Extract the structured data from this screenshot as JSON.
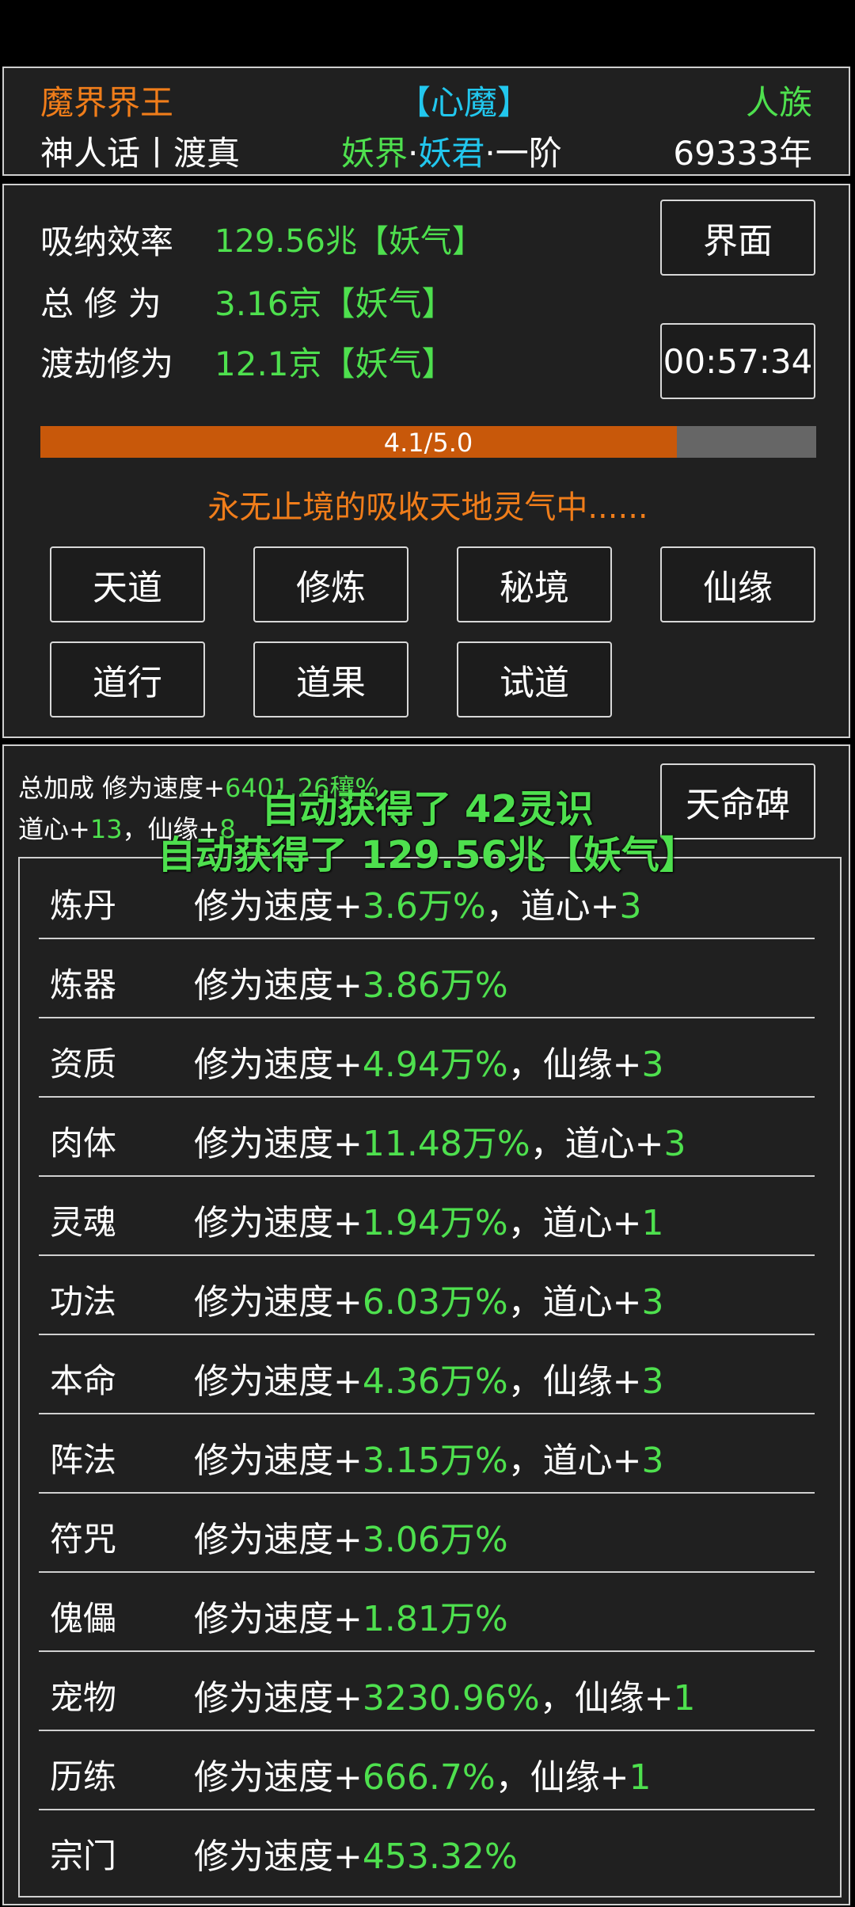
{
  "header": {
    "title_left": "魔界界王",
    "title_center": "【心魔】",
    "title_right": "人族",
    "sub_left": "神人话丨渡真",
    "realm_world": "妖界",
    "realm_dot1": "·",
    "realm_rank": "妖君",
    "realm_stage": "·一阶",
    "age": "69333年"
  },
  "stats": {
    "absorb_label": "吸纳效率",
    "absorb_value": "129.56兆【妖气】",
    "total_label": "总 修 为",
    "total_value": "3.16京【妖气】",
    "tribulation_label": "渡劫修为",
    "tribulation_value": "12.1京【妖气】",
    "interface_button": "界面",
    "timer": "00:57:34",
    "progress_text": "4.1/5.0",
    "progress_fraction": 0.82,
    "status_text": "永无止境的吸收天地灵气中......"
  },
  "actions": [
    "天道",
    "修炼",
    "秘境",
    "仙缘",
    "道行",
    "道果",
    "试道"
  ],
  "bonus": {
    "line1_label": "总加成 修为速度+",
    "line1_value": "6401.26穰%",
    "line2_dao_label": "道心+",
    "line2_dao_value": "13",
    "line2_sep": "，仙缘+",
    "line2_xian_value": "8",
    "tianming_button": "天命碑"
  },
  "notifications": {
    "line1": "自动获得了 42灵识",
    "line2": "自动获得了 129.56兆【妖气】"
  },
  "list": [
    {
      "name": "炼丹",
      "prefix": "修为速度+",
      "value": "3.6万%",
      "extra_label": "，道心+",
      "extra_value": "3"
    },
    {
      "name": "炼器",
      "prefix": "修为速度+",
      "value": "3.86万%",
      "extra_label": "",
      "extra_value": ""
    },
    {
      "name": "资质",
      "prefix": "修为速度+",
      "value": "4.94万%",
      "extra_label": "，仙缘+",
      "extra_value": "3"
    },
    {
      "name": "肉体",
      "prefix": "修为速度+",
      "value": "11.48万%",
      "extra_label": "，道心+",
      "extra_value": "3"
    },
    {
      "name": "灵魂",
      "prefix": "修为速度+",
      "value": "1.94万%",
      "extra_label": "，道心+",
      "extra_value": "1"
    },
    {
      "name": "功法",
      "prefix": "修为速度+",
      "value": "6.03万%",
      "extra_label": "，道心+",
      "extra_value": "3"
    },
    {
      "name": "本命",
      "prefix": "修为速度+",
      "value": "4.36万%",
      "extra_label": "，仙缘+",
      "extra_value": "3"
    },
    {
      "name": "阵法",
      "prefix": "修为速度+",
      "value": "3.15万%",
      "extra_label": "，道心+",
      "extra_value": "3"
    },
    {
      "name": "符咒",
      "prefix": "修为速度+",
      "value": "3.06万%",
      "extra_label": "",
      "extra_value": ""
    },
    {
      "name": "傀儡",
      "prefix": "修为速度+",
      "value": "1.81万%",
      "extra_label": "",
      "extra_value": ""
    },
    {
      "name": "宠物",
      "prefix": "修为速度+",
      "value": "3230.96%",
      "extra_label": "，仙缘+",
      "extra_value": "1"
    },
    {
      "name": "历练",
      "prefix": "修为速度+",
      "value": "666.7%",
      "extra_label": "，仙缘+",
      "extra_value": "1"
    },
    {
      "name": "宗门",
      "prefix": "修为速度+",
      "value": "453.32%",
      "extra_label": "",
      "extra_value": ""
    }
  ],
  "colors": {
    "accent_green": "#4ee04e",
    "accent_orange": "#f07d1a",
    "accent_cyan": "#22c7ee",
    "progress_fill": "#c8580a",
    "progress_track": "#666666"
  }
}
